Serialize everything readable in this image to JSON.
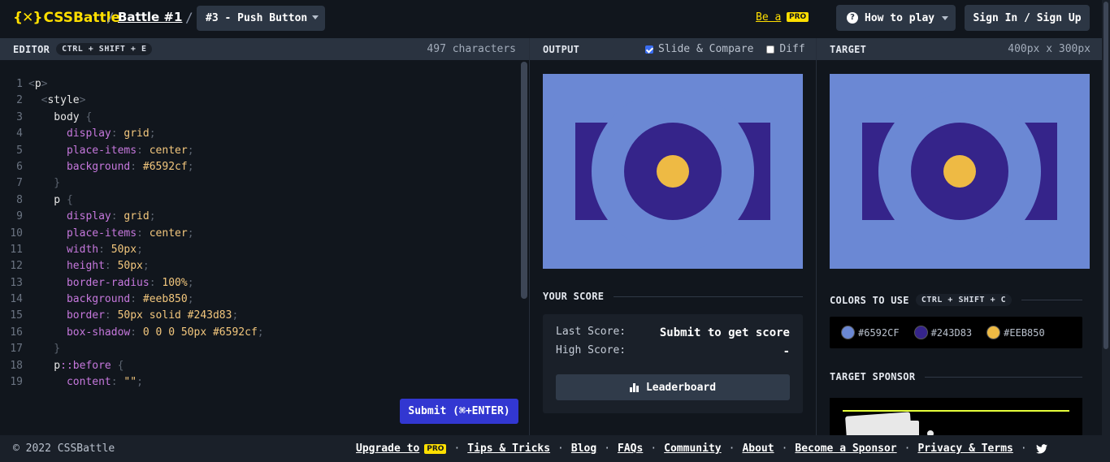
{
  "header": {
    "logo_text": "CSSBattle",
    "logo_mark": "{✕}",
    "battle_link": "Battle #1",
    "sep": "/",
    "current_target": "#3 - Push Button",
    "be_a": "Be a",
    "pro": "PRO",
    "how_to_play": "How to play",
    "sign_in": "Sign In / Sign Up"
  },
  "editor": {
    "title": "EDITOR",
    "shortcut": "CTRL + SHIFT + E",
    "char_count": "497 characters",
    "submit": "Submit (⌘+ENTER)",
    "lines": [
      {
        "n": "1",
        "tokens": [
          {
            "t": "<",
            "c": "t-punc"
          },
          {
            "t": "p",
            "c": "t-tag"
          },
          {
            "t": ">",
            "c": "t-punc"
          }
        ]
      },
      {
        "n": "2",
        "tokens": [
          {
            "t": "  <",
            "c": "t-punc"
          },
          {
            "t": "style",
            "c": "t-tag"
          },
          {
            "t": ">",
            "c": "t-punc"
          }
        ]
      },
      {
        "n": "3",
        "tokens": [
          {
            "t": "    body ",
            "c": "t-sel"
          },
          {
            "t": "{",
            "c": "t-punc"
          }
        ]
      },
      {
        "n": "4",
        "tokens": [
          {
            "t": "      display",
            "c": "t-prop"
          },
          {
            "t": ": ",
            "c": "t-punc"
          },
          {
            "t": "grid",
            "c": "t-val"
          },
          {
            "t": ";",
            "c": "t-punc"
          }
        ]
      },
      {
        "n": "5",
        "tokens": [
          {
            "t": "      place-items",
            "c": "t-prop"
          },
          {
            "t": ": ",
            "c": "t-punc"
          },
          {
            "t": "center",
            "c": "t-val"
          },
          {
            "t": ";",
            "c": "t-punc"
          }
        ]
      },
      {
        "n": "6",
        "tokens": [
          {
            "t": "      background",
            "c": "t-prop"
          },
          {
            "t": ": ",
            "c": "t-punc"
          },
          {
            "t": "#6592cf",
            "c": "t-val"
          },
          {
            "t": ";",
            "c": "t-punc"
          }
        ]
      },
      {
        "n": "7",
        "tokens": [
          {
            "t": "    }",
            "c": "t-punc"
          }
        ]
      },
      {
        "n": "8",
        "tokens": [
          {
            "t": "    p ",
            "c": "t-sel"
          },
          {
            "t": "{",
            "c": "t-punc"
          }
        ]
      },
      {
        "n": "9",
        "tokens": [
          {
            "t": "      display",
            "c": "t-prop"
          },
          {
            "t": ": ",
            "c": "t-punc"
          },
          {
            "t": "grid",
            "c": "t-val"
          },
          {
            "t": ";",
            "c": "t-punc"
          }
        ]
      },
      {
        "n": "10",
        "tokens": [
          {
            "t": "      place-items",
            "c": "t-prop"
          },
          {
            "t": ": ",
            "c": "t-punc"
          },
          {
            "t": "center",
            "c": "t-val"
          },
          {
            "t": ";",
            "c": "t-punc"
          }
        ]
      },
      {
        "n": "11",
        "tokens": [
          {
            "t": "      width",
            "c": "t-prop"
          },
          {
            "t": ": ",
            "c": "t-punc"
          },
          {
            "t": "50px",
            "c": "t-val"
          },
          {
            "t": ";",
            "c": "t-punc"
          }
        ]
      },
      {
        "n": "12",
        "tokens": [
          {
            "t": "      height",
            "c": "t-prop"
          },
          {
            "t": ": ",
            "c": "t-punc"
          },
          {
            "t": "50px",
            "c": "t-val"
          },
          {
            "t": ";",
            "c": "t-punc"
          }
        ]
      },
      {
        "n": "13",
        "tokens": [
          {
            "t": "      border-radius",
            "c": "t-prop"
          },
          {
            "t": ": ",
            "c": "t-punc"
          },
          {
            "t": "100%",
            "c": "t-val"
          },
          {
            "t": ";",
            "c": "t-punc"
          }
        ]
      },
      {
        "n": "14",
        "tokens": [
          {
            "t": "      background",
            "c": "t-prop"
          },
          {
            "t": ": ",
            "c": "t-punc"
          },
          {
            "t": "#eeb850",
            "c": "t-val"
          },
          {
            "t": ";",
            "c": "t-punc"
          }
        ]
      },
      {
        "n": "15",
        "tokens": [
          {
            "t": "      border",
            "c": "t-prop"
          },
          {
            "t": ": ",
            "c": "t-punc"
          },
          {
            "t": "50px solid #243d83",
            "c": "t-val"
          },
          {
            "t": ";",
            "c": "t-punc"
          }
        ]
      },
      {
        "n": "16",
        "tokens": [
          {
            "t": "      box-shadow",
            "c": "t-prop"
          },
          {
            "t": ": ",
            "c": "t-punc"
          },
          {
            "t": "0 0 0 50px #6592cf",
            "c": "t-val"
          },
          {
            "t": ";",
            "c": "t-punc"
          }
        ]
      },
      {
        "n": "17",
        "tokens": [
          {
            "t": "    }",
            "c": "t-punc"
          }
        ]
      },
      {
        "n": "18",
        "tokens": [
          {
            "t": "    p",
            "c": "t-sel"
          },
          {
            "t": "::before ",
            "c": "t-pseudo"
          },
          {
            "t": "{",
            "c": "t-punc"
          }
        ]
      },
      {
        "n": "19",
        "tokens": [
          {
            "t": "      content",
            "c": "t-prop"
          },
          {
            "t": ": ",
            "c": "t-punc"
          },
          {
            "t": "\"\"",
            "c": "t-val"
          },
          {
            "t": ";",
            "c": "t-punc"
          }
        ]
      }
    ]
  },
  "output": {
    "title": "OUTPUT",
    "slide_compare": "Slide & Compare",
    "diff": "Diff",
    "your_score": "YOUR SCORE",
    "last_score_label": "Last Score:",
    "last_score_value": "Submit to get score",
    "high_score_label": "High Score:",
    "high_score_value": "-",
    "leaderboard": "Leaderboard"
  },
  "target": {
    "title": "TARGET",
    "dims": "400px x 300px",
    "colors_to_use": "COLORS TO USE",
    "colors_shortcut": "CTRL + SHIFT + C",
    "colors": [
      {
        "hex": "#6592CF",
        "swatch": "#6b88d4"
      },
      {
        "hex": "#243D83",
        "swatch": "#35248a"
      },
      {
        "hex": "#EEB850",
        "swatch": "#eeba44"
      }
    ],
    "target_sponsor": "TARGET SPONSOR"
  },
  "footer": {
    "copyright": "© 2022 CSSBattle",
    "links": {
      "upgrade": "Upgrade to",
      "tips": "Tips & Tricks",
      "blog": "Blog",
      "faqs": "FAQs",
      "community": "Community",
      "about": "About",
      "sponsor": "Become a Sponsor",
      "privacy": "Privacy & Terms"
    },
    "pro": "PRO"
  },
  "icons": [
    "question-icon",
    "chevron-down-icon",
    "leaderboard-bars-icon",
    "twitter-icon",
    "checkbox-icon"
  ]
}
